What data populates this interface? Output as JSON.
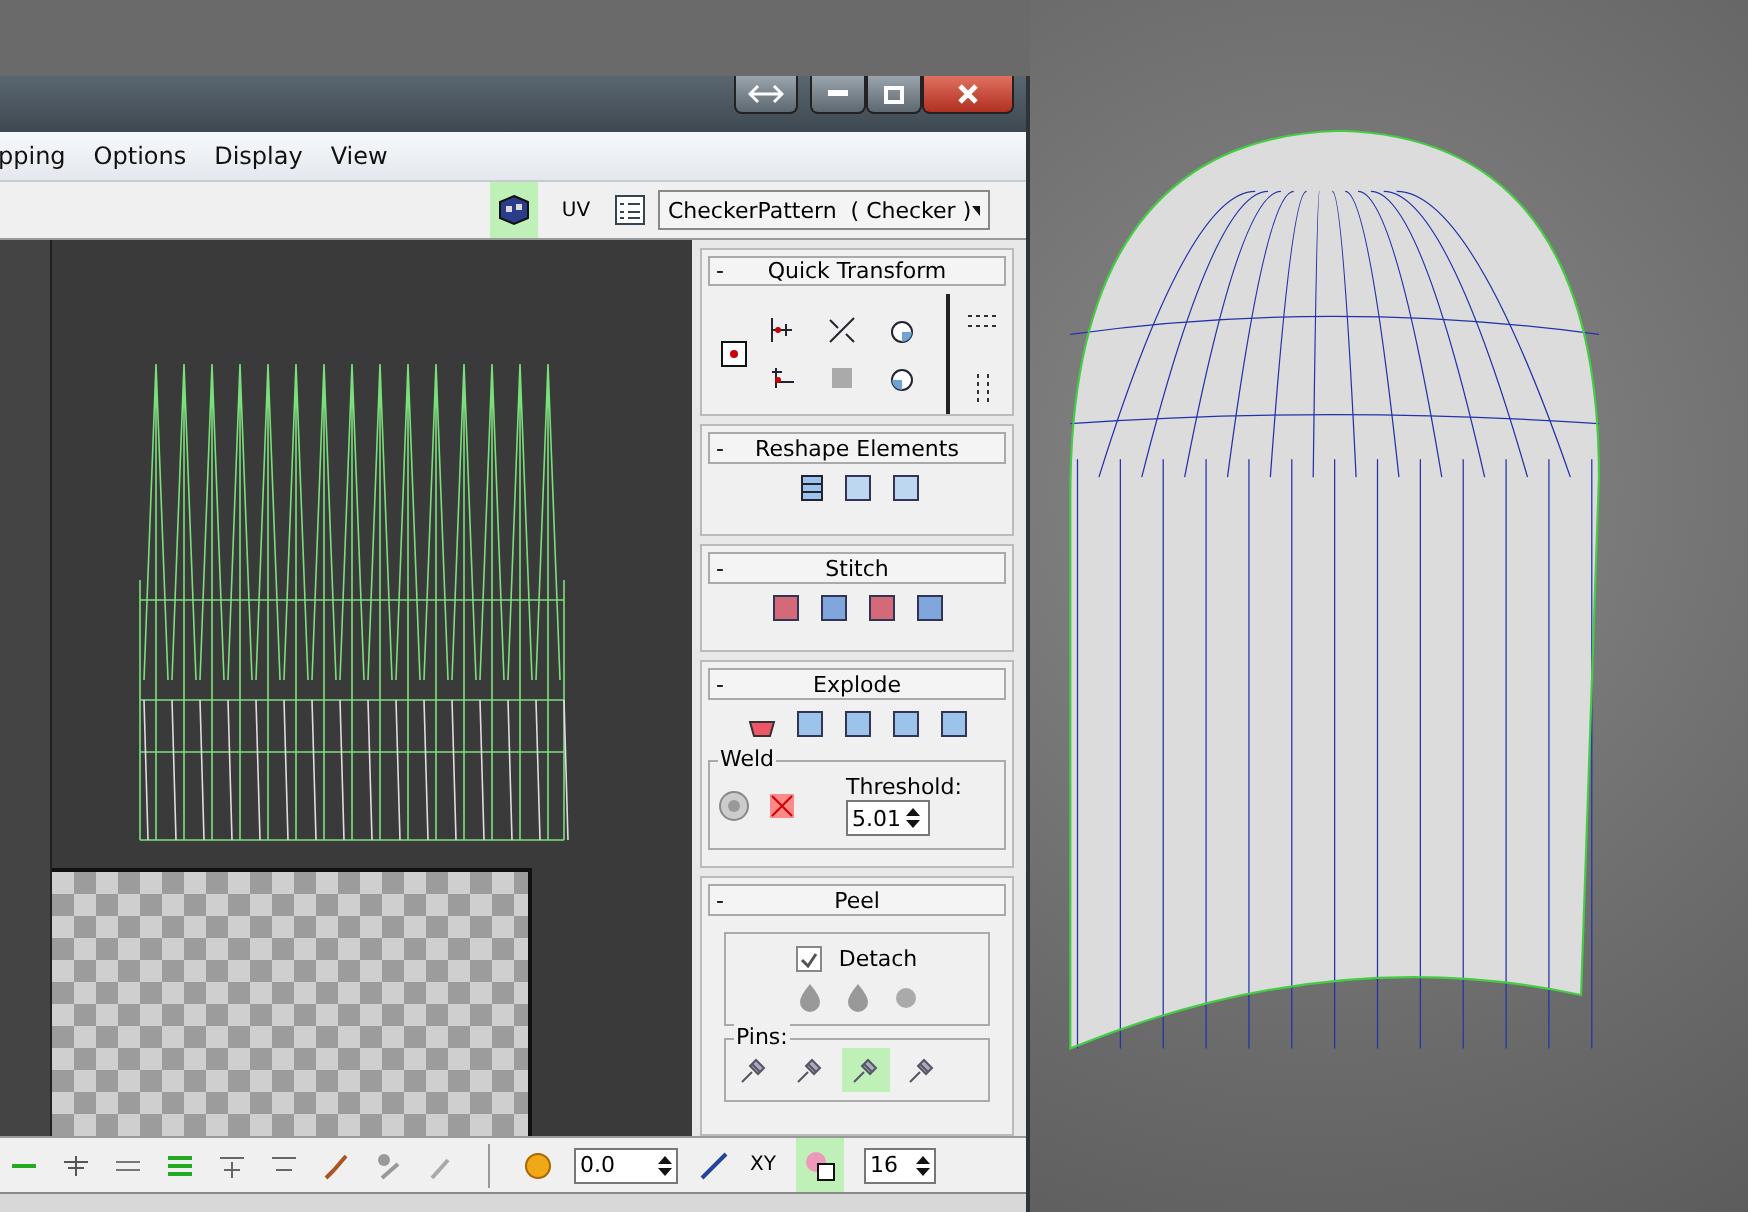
{
  "menu": [
    "pping",
    "Options",
    "Display",
    "View"
  ],
  "toolbar": {
    "map_toggle_on": true,
    "uv_label": "UV",
    "texture_dropdown": "CheckerPattern  ( Checker )"
  },
  "rollouts": {
    "collapse_sign": "-",
    "quick_transform": "Quick Transform",
    "reshape_elements": "Reshape Elements",
    "stitch": "Stitch",
    "explode": "Explode",
    "peel": "Peel"
  },
  "weld": {
    "label": "Weld",
    "threshold_label": "Threshold:",
    "threshold": "5.01"
  },
  "peel": {
    "detach_checked": true,
    "detach_label": "Detach",
    "pins_label": "Pins:",
    "pins": [
      {
        "selected": false
      },
      {
        "selected": false
      },
      {
        "selected": true
      },
      {
        "selected": false
      }
    ]
  },
  "bottom_toolbar": {
    "value": "0.0",
    "axis": "XY",
    "snap_on": true,
    "snap_value": "16"
  }
}
